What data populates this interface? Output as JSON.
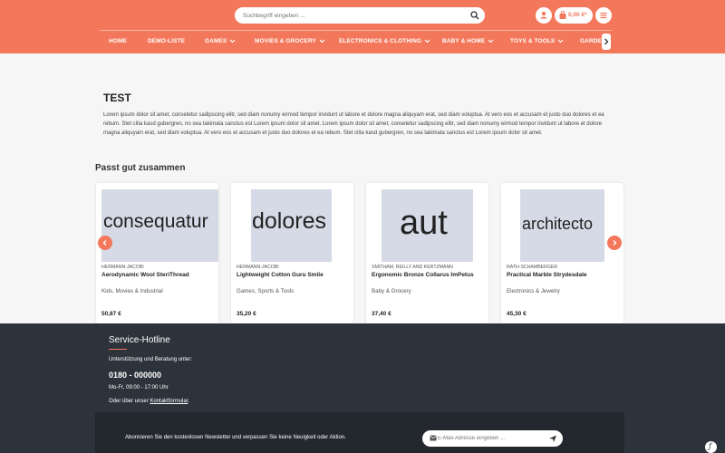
{
  "colors": {
    "accent": "#f3775a",
    "footer": "#2d333b",
    "thumb": "#d6dae6"
  },
  "header": {
    "search_placeholder": "Suchbegriff eingeben ...",
    "cart_total": "0,00 €*",
    "nav": [
      "HOME",
      "DEMO-LISTE",
      "GAMES",
      "MOVIES & GROCERY",
      "ELECTRONICS & CLOTHING",
      "BABY & HOME",
      "TOYS & TOOLS",
      "GARDEN"
    ]
  },
  "cms": {
    "title": "TEST",
    "text": "Lorem ipsum dolor sit amet, consetetur sadipscing elitr, sed diam nonumy eirmod tempor invidunt ut labore et dolore magna aliquyam erat, sed diam voluptua. At vero eos et accusam et justo duo dolores et ea rebum. Stet clita kasd gubergren, no sea takimata sanctus est Lorem ipsum dolor sit amet. Lorem ipsum dolor sit amet, consetetur sadipscing elitr, sed diam nonumy eirmod tempor invidunt ut labore et dolore magna aliquyam erat, sed diam voluptua. At vero eos et accusam et justo duo dolores et ea rebum. Stet clita kasd gubergren, no sea takimata sanctus est Lorem ipsum dolor sit amet."
  },
  "crossselling": {
    "title": "Passt gut zusammen",
    "products": [
      {
        "image_text": "consequatur",
        "brand": "HERMANN-JACOBI",
        "name": "Aerodynamic Wool SteriThread",
        "category": "Kids, Movies & Industrial",
        "price": "50,87 €"
      },
      {
        "image_text": "dolores",
        "brand": "HERMANN-JACOBI",
        "name": "Lightweight Cotton Guru Smile",
        "category": "Games, Sports & Tools",
        "price": "35,20 €"
      },
      {
        "image_text": "aut",
        "brand": "SMITHAM, REILLY AND KERTZMANN",
        "name": "Ergonomic Bronze Collarus ImPetus",
        "category": "Baby & Grocery",
        "price": "37,40 €"
      },
      {
        "image_text": "architecto",
        "brand": "RATH-SCHAMBERGER",
        "name": "Practical Marble Strydesdale",
        "category": "Electronics & Jewelry",
        "price": "45,30 €"
      }
    ]
  },
  "footer": {
    "hotline_title": "Service-Hotline",
    "hotline_sub": "Unterstützung und Beratung unter:",
    "hotline_number": "0180 - 000000",
    "hotline_hours": "Mo-Fr, 09:00 - 17:00 Uhr",
    "contact_prefix": "Oder über unser ",
    "contact_link": "Kontaktformular",
    "contact_suffix": ".",
    "newsletter_text": "Abonnieren Sie den kostenlosen Newsletter und verpassen Sie keine Neuigkeit oder Aktion.",
    "newsletter_placeholder": "E-Mail-Adresse eingeben ..."
  }
}
